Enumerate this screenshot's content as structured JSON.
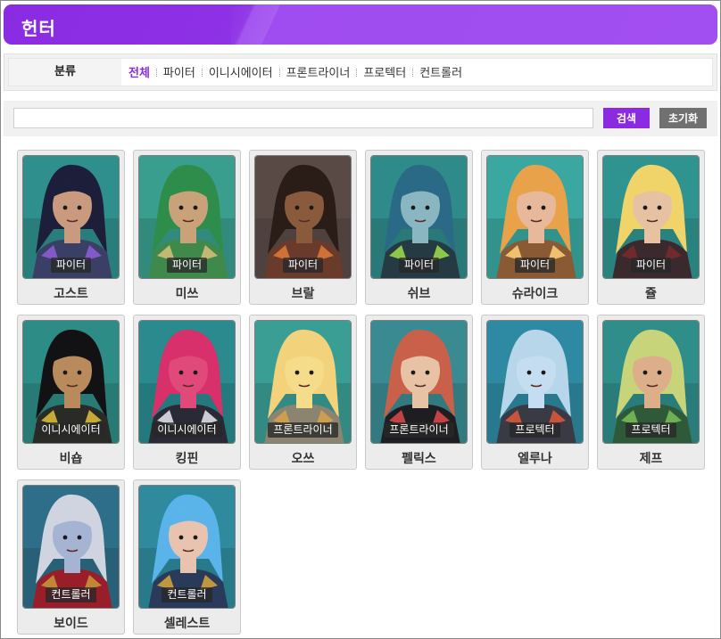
{
  "header": {
    "title": "헌터"
  },
  "filter": {
    "label": "분류",
    "categories": [
      "전체",
      "파이터",
      "이니시에이터",
      "프론트라이너",
      "프로텍터",
      "컨트롤러"
    ],
    "active_index": 0
  },
  "search": {
    "value": "",
    "button_label": "검색",
    "reset_label": "초기화"
  },
  "heroes": [
    {
      "name": "고스트",
      "role": "파이터",
      "palette": {
        "bg": "#2f8f8c",
        "hair": "#1c1e3a",
        "skin": "#c99a7e",
        "cloth": "#3a3f66",
        "accent": "#8f5ed8"
      }
    },
    {
      "name": "미쓰",
      "role": "파이터",
      "palette": {
        "bg": "#3a9e8f",
        "hair": "#2f8d4c",
        "skin": "#caa27a",
        "cloth": "#3f8a4a",
        "accent": "#d8c07a"
      }
    },
    {
      "name": "브랄",
      "role": "파이터",
      "palette": {
        "bg": "#5a4a46",
        "hair": "#2a1c16",
        "skin": "#8a5a3c",
        "cloth": "#6a3a2a",
        "accent": "#e07a3a"
      }
    },
    {
      "name": "쉬브",
      "role": "파이터",
      "palette": {
        "bg": "#2f8a8a",
        "hair": "#2a6a86",
        "skin": "#8ab6c2",
        "cloth": "#263a44",
        "accent": "#9fe04a"
      }
    },
    {
      "name": "슈라이크",
      "role": "파이터",
      "palette": {
        "bg": "#3aa7a0",
        "hair": "#e8a24a",
        "skin": "#e8b89a",
        "cloth": "#8a5a34",
        "accent": "#ffd27a"
      }
    },
    {
      "name": "쥴",
      "role": "파이터",
      "palette": {
        "bg": "#2f9490",
        "hair": "#f0d46a",
        "skin": "#e6c2a2",
        "cloth": "#3a2a2e",
        "accent": "#7a2a2a"
      }
    },
    {
      "name": "비숍",
      "role": "이니시에이터",
      "palette": {
        "bg": "#2e8c86",
        "hair": "#121214",
        "skin": "#b88a5c",
        "cloth": "#2a2a26",
        "accent": "#e0c23a"
      }
    },
    {
      "name": "킹핀",
      "role": "이니시에이터",
      "palette": {
        "bg": "#2a8a8e",
        "hair": "#d8306a",
        "skin": "#e04a7a",
        "cloth": "#2a2a36",
        "accent": "#e8e8f0"
      }
    },
    {
      "name": "오쓰",
      "role": "프론트라이너",
      "palette": {
        "bg": "#3a9e94",
        "hair": "#f2d27a",
        "skin": "#f4dc8a",
        "cloth": "#8a8470",
        "accent": "#d8a24a"
      }
    },
    {
      "name": "펠릭스",
      "role": "프론트라이너",
      "palette": {
        "bg": "#3a8a92",
        "hair": "#c8604a",
        "skin": "#e8c2a4",
        "cloth": "#1e1e22",
        "accent": "#e04a4a"
      }
    },
    {
      "name": "엘루나",
      "role": "프로텍터",
      "palette": {
        "bg": "#2e8aa2",
        "hair": "#b8d6ea",
        "skin": "#c4ddf0",
        "cloth": "#3a3a44",
        "accent": "#e05a3a"
      }
    },
    {
      "name": "제프",
      "role": "프로텍터",
      "palette": {
        "bg": "#2f8e8a",
        "hair": "#c8d47a",
        "skin": "#dcae8a",
        "cloth": "#2e5a3a",
        "accent": "#7ac05a"
      }
    },
    {
      "name": "보이드",
      "role": "컨트롤러",
      "palette": {
        "bg": "#2e6e88",
        "hair": "#d0d4e0",
        "skin": "#a4b4d2",
        "cloth": "#9a1e2a",
        "accent": "#c89a3a"
      }
    },
    {
      "name": "셀레스트",
      "role": "컨트롤러",
      "palette": {
        "bg": "#2e8a9c",
        "hair": "#5ab4ea",
        "skin": "#e8c4b0",
        "cloth": "#2a3a5a",
        "accent": "#d8a83a"
      }
    }
  ]
}
